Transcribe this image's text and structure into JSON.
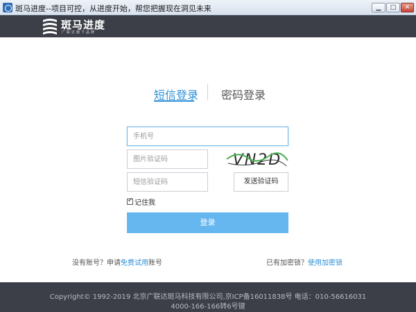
{
  "window": {
    "title": "斑马进度--项目可控，从进度开始，帮您把握现在洞见未来",
    "min_symbol": "▁",
    "max_symbol": "□",
    "close_symbol": "✕"
  },
  "brand": {
    "name": "斑马进度",
    "tagline": "广联达旗下品牌",
    "logo_icon": "zebra-stripes-logo"
  },
  "tabs": [
    {
      "label": "短信登录",
      "active": true
    },
    {
      "label": "密码登录",
      "active": false
    }
  ],
  "form": {
    "phone_placeholder": "手机号",
    "captcha_placeholder": "图片验证码",
    "sms_placeholder": "短信验证码",
    "captcha_text": "VN2D",
    "send_code_label": "发送验证码",
    "remember_label": "记住我",
    "remember_checked": true,
    "login_label": "登录"
  },
  "links": {
    "no_account_prefix": "没有账号？申请",
    "free_trial": "免费试用",
    "no_account_suffix": "账号",
    "have_dongle_prefix": "已有加密锁？",
    "use_dongle": "使用加密锁"
  },
  "footer": {
    "line1": "Copyright© 1992-2019 北京广联达斑马科技有限公司,京ICP备16011838号 电话：010-56616031",
    "line2": "4000-166-166转6号键"
  },
  "colors": {
    "accent": "#2c8fd6",
    "login_button": "#66b7f0",
    "dark_bar": "#3c3f48"
  }
}
